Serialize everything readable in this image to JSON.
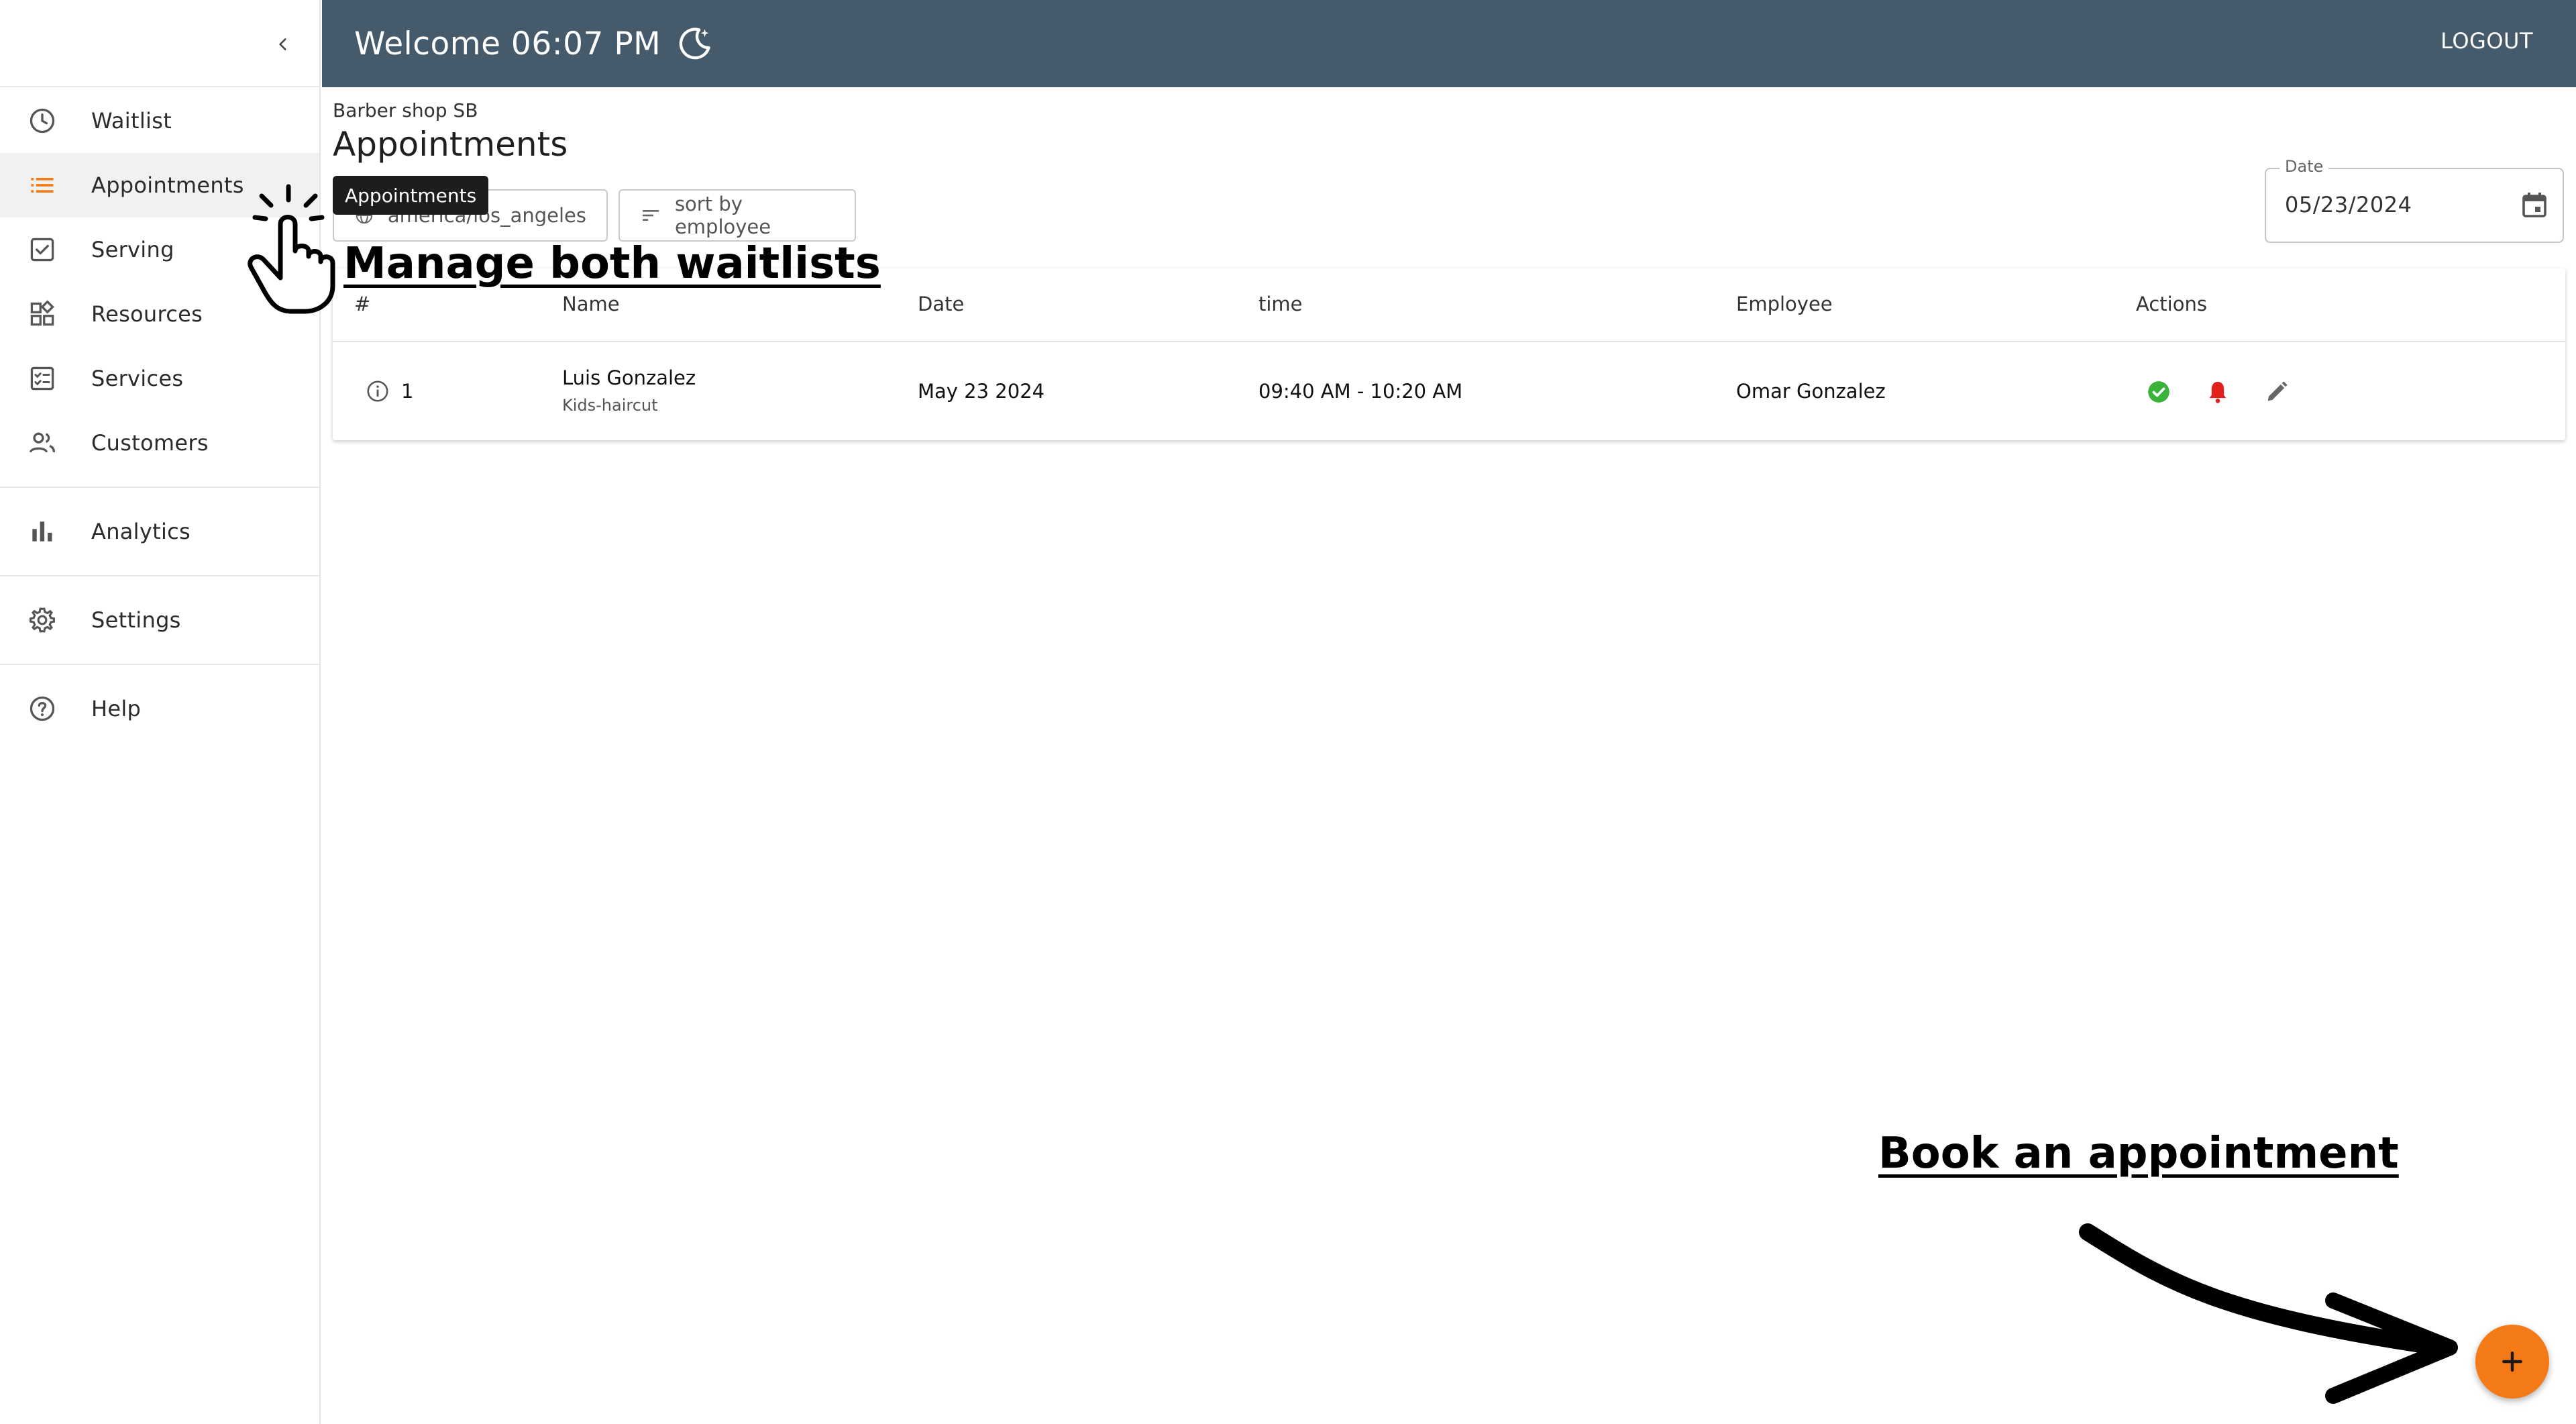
{
  "header": {
    "welcome_text": "Welcome 06:07 PM",
    "logout_label": "LOGOUT",
    "color": "#455a6b"
  },
  "sidebar": {
    "items": [
      {
        "label": "Waitlist",
        "icon": "clock-icon"
      },
      {
        "label": "Appointments",
        "icon": "list-icon",
        "active": true
      },
      {
        "label": "Serving",
        "icon": "checkbox-icon"
      },
      {
        "label": "Resources",
        "icon": "widgets-icon"
      },
      {
        "label": "Services",
        "icon": "checklist-icon"
      },
      {
        "label": "Customers",
        "icon": "people-icon"
      },
      {
        "label": "Analytics",
        "icon": "bar-chart-icon"
      },
      {
        "label": "Settings",
        "icon": "gear-icon"
      },
      {
        "label": "Help",
        "icon": "help-icon"
      }
    ],
    "accent": "#f47a17"
  },
  "tooltip": {
    "text": "Appointments"
  },
  "main": {
    "shop_name": "Barber shop SB",
    "title": "Appointments",
    "timezone_chip": "america/los_angeles",
    "sort_chip": "sort by employee",
    "date": {
      "label": "Date",
      "value": "05/23/2024"
    }
  },
  "table": {
    "headers": [
      "#",
      "Name",
      "Date",
      "time",
      "Employee",
      "Actions"
    ],
    "rows": [
      {
        "number": "1",
        "name": "Luis Gonzalez",
        "service": "Kids-haircut",
        "date": "May 23 2024",
        "time": "09:40 AM - 10:20 AM",
        "employee": "Omar Gonzalez",
        "actions": [
          "check-circle-icon",
          "bell-icon",
          "pencil-icon"
        ]
      }
    ]
  },
  "annotations": {
    "manage": "Manage both waitlists",
    "book": "Book an appointment"
  },
  "fab": {
    "icon": "plus-icon",
    "color": "#f47a17"
  }
}
